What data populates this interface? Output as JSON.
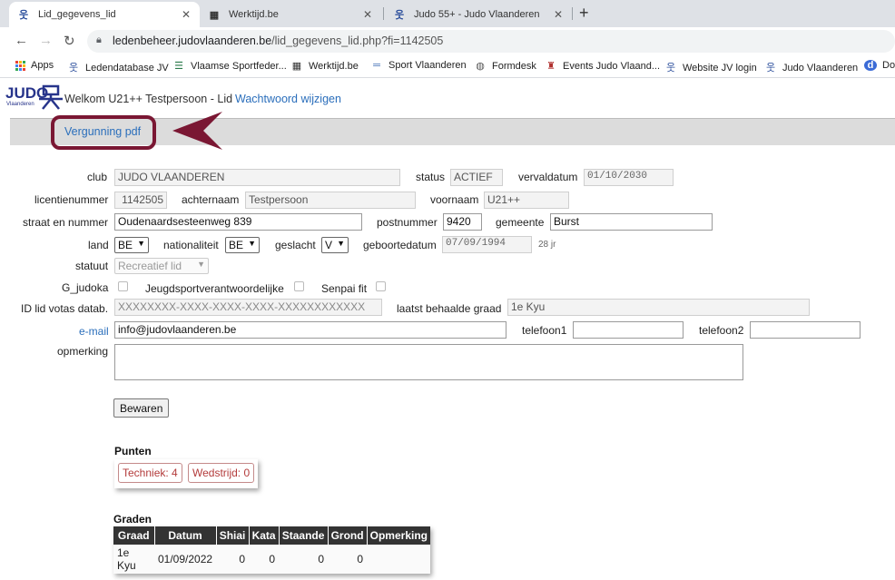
{
  "browser": {
    "tabs": [
      {
        "title": "Lid_gegevens_lid",
        "icon": "judo-icon",
        "active": true
      },
      {
        "title": "Werktijd.be",
        "icon": "calendar-icon",
        "active": false
      },
      {
        "title": "Judo 55+ - Judo Vlaanderen",
        "icon": "judo-icon",
        "active": false
      }
    ],
    "url_host": "ledenbeheer.judovlaanderen.be",
    "url_path": "/lid_gegevens_lid.php?fi=1142505",
    "bookmarks": [
      {
        "label": "Apps"
      },
      {
        "label": "Ledendatabase JV"
      },
      {
        "label": "Vlaamse Sportfeder..."
      },
      {
        "label": "Werktijd.be"
      },
      {
        "label": "Sport Vlaanderen"
      },
      {
        "label": "Formdesk"
      },
      {
        "label": "Events Judo Vlaand..."
      },
      {
        "label": "Website JV login"
      },
      {
        "label": "Judo Vlaanderen"
      },
      {
        "label": "Do"
      }
    ]
  },
  "header": {
    "logo_text": "JUDO",
    "logo_sub": "Vlaanderen",
    "welcome": "Welkom U21++ Testpersoon - Lid",
    "password_link": "Wachtwoord wijzigen",
    "pdf_link": "Vergunning pdf"
  },
  "form": {
    "club_label": "club",
    "club": "JUDO VLAANDEREN",
    "status_label": "status",
    "status": "ACTIEF",
    "vervaldatum_label": "vervaldatum",
    "vervaldatum": "01/10/2030",
    "licentie_label": "licentienummer",
    "licentie": "1142505",
    "achternaam_label": "achternaam",
    "achternaam": "Testpersoon",
    "voornaam_label": "voornaam",
    "voornaam": "U21++",
    "straat_label": "straat en nummer",
    "straat": "Oudenaardsesteenweg 839",
    "postnummer_label": "postnummer",
    "postnummer": "9420",
    "gemeente_label": "gemeente",
    "gemeente": "Burst",
    "land_label": "land",
    "land": "BE",
    "nationaliteit_label": "nationaliteit",
    "nationaliteit": "BE",
    "geslacht_label": "geslacht",
    "geslacht": "V",
    "geboortedatum_label": "geboortedatum",
    "geboortedatum": "07/09/1994",
    "leeftijd": "28 jr",
    "statuut_label": "statuut",
    "statuut": "Recreatief lid",
    "gjudoka_label": "G_judoka",
    "jeugd_label": "Jeugdsportverantwoordelijke",
    "senpai_label": "Senpai fit",
    "votas_label": "ID lid votas datab.",
    "votas": "XXXXXXXX-XXXX-XXXX-XXXX-XXXXXXXXXXXX",
    "graad_label": "laatst behaalde graad",
    "graad": "1e Kyu",
    "email_label": "e-mail",
    "email": "info@judovlaanderen.be",
    "tel1_label": "telefoon1",
    "tel1": "",
    "tel2_label": "telefoon2",
    "tel2": "",
    "opmerking_label": "opmerking",
    "opmerking": "",
    "save_label": "Bewaren"
  },
  "punten": {
    "title": "Punten",
    "techniek": "Techniek: 4",
    "wedstrijd": "Wedstrijd: 0"
  },
  "graden": {
    "title": "Graden",
    "headers": [
      "Graad",
      "Datum",
      "Shiai",
      "Kata",
      "Staande",
      "Grond",
      "Opmerking"
    ],
    "rows": [
      [
        "1e Kyu",
        "01/09/2022",
        "0",
        "0",
        "0",
        "0",
        ""
      ]
    ]
  }
}
